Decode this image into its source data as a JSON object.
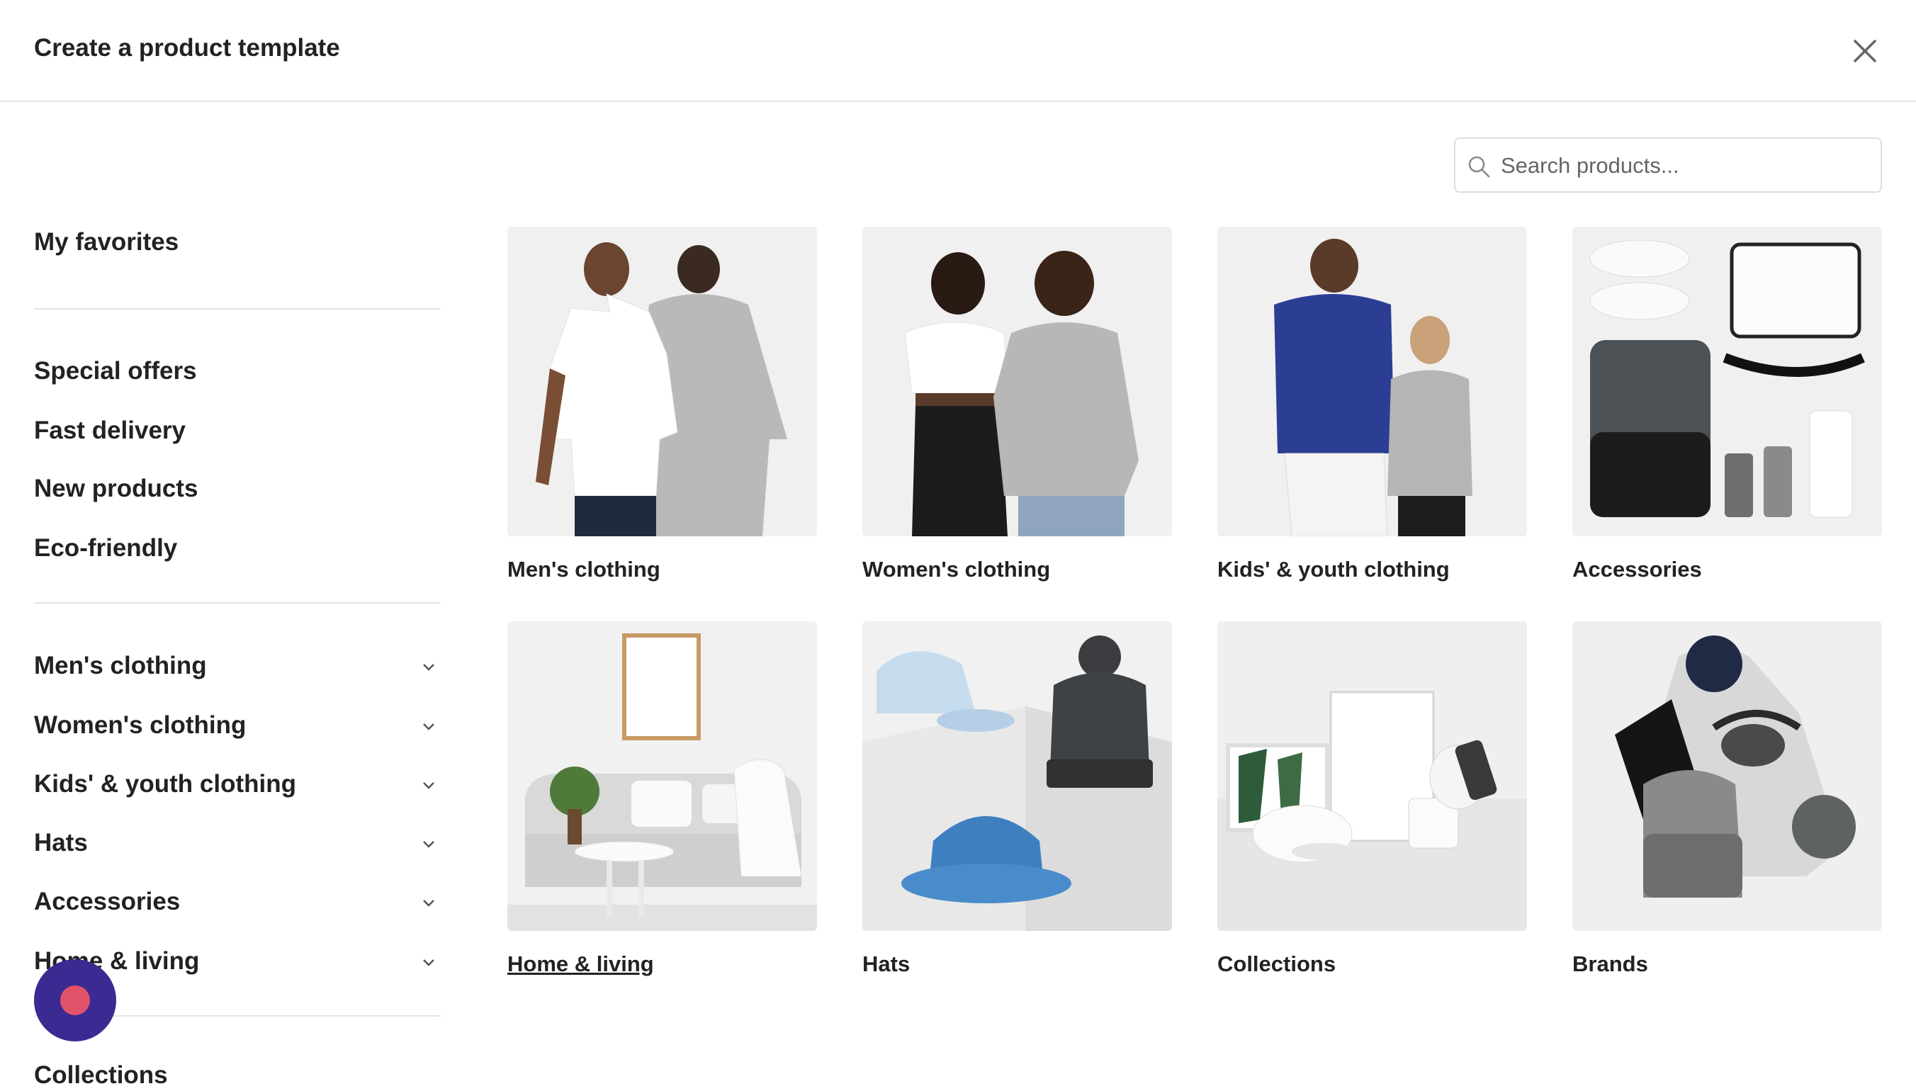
{
  "header": {
    "title": "Create a product template"
  },
  "search": {
    "placeholder": "Search products..."
  },
  "sidebar": {
    "favorites": "My favorites",
    "quick_links": [
      "Special offers",
      "Fast delivery",
      "New products",
      "Eco-friendly"
    ],
    "categories": [
      "Men's clothing",
      "Women's clothing",
      "Kids' & youth clothing",
      "Hats",
      "Accessories",
      "Home & living"
    ],
    "partial": "Collections"
  },
  "cards": [
    {
      "label": "Men's clothing"
    },
    {
      "label": "Women's clothing"
    },
    {
      "label": "Kids' & youth clothing"
    },
    {
      "label": "Accessories"
    },
    {
      "label": "Home & living"
    },
    {
      "label": "Hats"
    },
    {
      "label": "Collections"
    },
    {
      "label": "Brands"
    }
  ],
  "colors": {
    "accent": "#3b2a91",
    "chat_dot": "#e1536b",
    "divider": "#e4e4e4"
  },
  "icons": {
    "close": "close-icon",
    "search": "search-icon",
    "chevron": "chevron-down-icon",
    "chat": "chat-launcher-icon"
  }
}
